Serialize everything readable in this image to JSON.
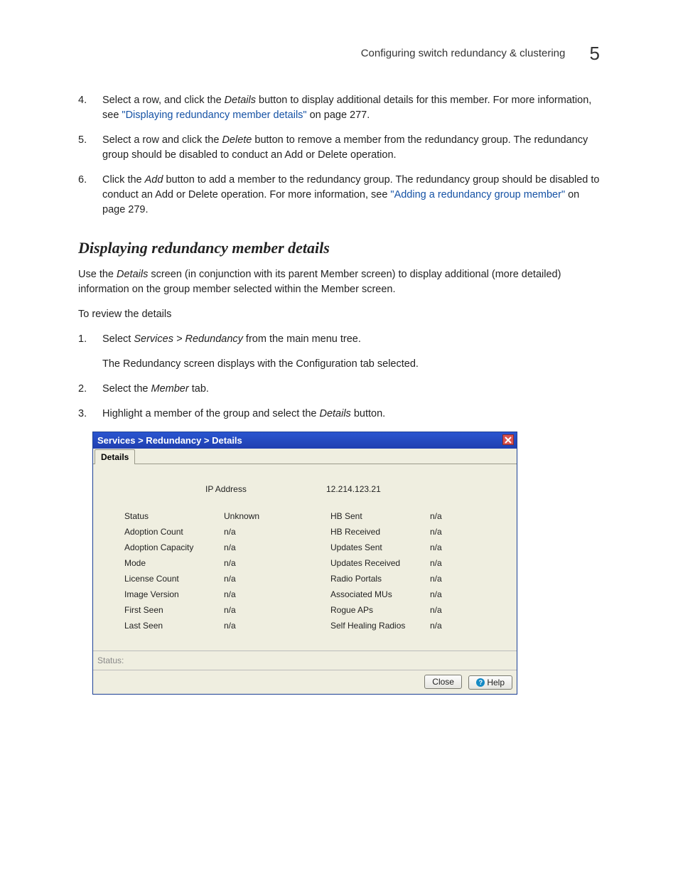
{
  "header": {
    "running_title": "Configuring switch redundancy & clustering",
    "chapter_number": "5"
  },
  "steps_a": [
    {
      "num": "4.",
      "pre": "Select a row, and click the ",
      "em1": "Details",
      "mid1": " button to display additional details for this member. For more information, see ",
      "link": "\"Displaying redundancy member details\"",
      "post": " on page 277."
    },
    {
      "num": "5.",
      "pre": "Select a row and click the ",
      "em1": "Delete",
      "mid1": " button to remove a member from the redundancy group. The redundancy group should be disabled to conduct an Add or Delete operation.",
      "link": "",
      "post": ""
    },
    {
      "num": "6.",
      "pre": "Click the ",
      "em1": "Add",
      "mid1": " button to add a member to the redundancy group. The redundancy group should be disabled to conduct an Add or Delete operation. For more information, see ",
      "link": "\"Adding a redundancy group member\"",
      "post": " on page 279."
    }
  ],
  "section_heading": "Displaying redundancy member details",
  "intro_para_pre": "Use the ",
  "intro_para_em": "Details",
  "intro_para_post": " screen (in conjunction with its parent Member screen) to display additional (more detailed) information on the group member selected within the Member screen.",
  "review_para": "To review the details",
  "steps_b": [
    {
      "num": "1.",
      "pre": "Select ",
      "em1": "Services > Redundancy",
      "post": " from the main menu tree.",
      "sub": "The Redundancy screen displays with the Configuration tab selected."
    },
    {
      "num": "2.",
      "pre": "Select the ",
      "em1": "Member",
      "post": " tab.",
      "sub": ""
    },
    {
      "num": "3.",
      "pre": "Highlight a member of the group and select the ",
      "em1": "Details",
      "post": " button.",
      "sub": ""
    }
  ],
  "dialog": {
    "title": "Services > Redundancy > Details",
    "tab": "Details",
    "ip_label": "IP Address",
    "ip_value": "12.214.123.21",
    "left_labels": [
      "Status",
      "Adoption Count",
      "Adoption Capacity",
      "Mode",
      "License Count",
      "Image Version",
      "First Seen",
      "Last Seen"
    ],
    "left_values": [
      "Unknown",
      "n/a",
      "n/a",
      "n/a",
      "n/a",
      "n/a",
      "n/a",
      "n/a"
    ],
    "right_labels": [
      "HB Sent",
      "HB Received",
      "Updates Sent",
      "Updates Received",
      "Radio Portals",
      "Associated MUs",
      "Rogue APs",
      "Self Healing Radios"
    ],
    "right_values": [
      "n/a",
      "n/a",
      "n/a",
      "n/a",
      "n/a",
      "n/a",
      "n/a",
      "n/a"
    ],
    "status_label": "Status:",
    "close_btn": "Close",
    "help_btn": "Help"
  }
}
